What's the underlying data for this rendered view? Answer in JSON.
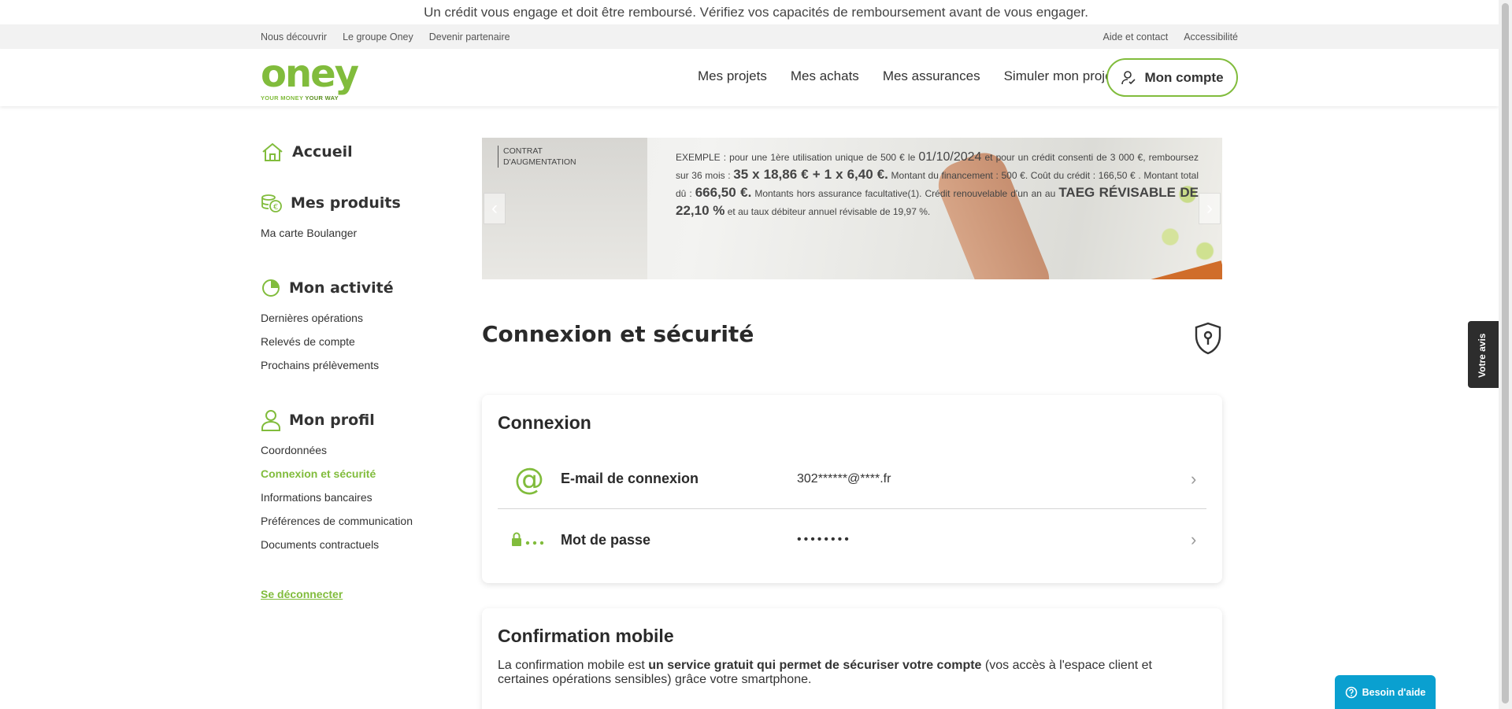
{
  "legal_notice": "Un crédit vous engage et doit être remboursé. Vérifiez vos capacités de remboursement avant de vous engager.",
  "topbar": {
    "left": [
      "Nous découvrir",
      "Le groupe Oney",
      "Devenir partenaire"
    ],
    "right": [
      "Aide et contact",
      "Accessibilité"
    ]
  },
  "header": {
    "logo_word": "oney",
    "logo_tagline_1": "YOUR MONEY",
    "logo_tagline_2": "YOUR WAY",
    "nav": [
      "Mes projets",
      "Mes achats",
      "Mes assurances",
      "Simuler mon projet"
    ],
    "account_button": "Mon compte"
  },
  "sidebar": {
    "home": "Accueil",
    "products": {
      "title": "Mes produits",
      "items": [
        "Ma carte Boulanger"
      ]
    },
    "activity": {
      "title": "Mon activité",
      "items": [
        "Dernières opérations",
        "Relevés de compte",
        "Prochains prélèvements"
      ]
    },
    "profile": {
      "title": "Mon profil",
      "items": [
        "Coordonnées",
        "Connexion et sécurité",
        "Informations bancaires",
        "Préférences de communication",
        "Documents contractuels"
      ]
    },
    "logout": "Se déconnecter"
  },
  "banner": {
    "contract_1": "CONTRAT",
    "contract_2": "D'AUGMENTATION",
    "ex_1": "EXEMPLE : pour une 1ère utilisation unique de 500 € le ",
    "ex_date": "01/10/2024",
    "ex_2": " et pour un crédit consenti de 3 000 €, remboursez sur 36 mois : ",
    "ex_monthly": "35 x 18,86 € + 1 x 6,40 €.",
    "ex_3": " Montant du financement : 500 €. Coût du crédit : 166,50 € . Montant total dû : ",
    "ex_total": "666,50 €.",
    "ex_4": " Montants hors assurance facultative(1). Crédit renouvelable d'un an au ",
    "ex_taeg": "TAEG RÉVISABLE DE 22,10 %",
    "ex_5": " et au taux débiteur annuel révisable de 19,97 %."
  },
  "page_title": "Connexion et sécurité",
  "connexion": {
    "title": "Connexion",
    "email_label": "E-mail de connexion",
    "email_value": "302******@****.fr",
    "password_label": "Mot de passe",
    "password_value": "••••••••"
  },
  "mobile": {
    "title": "Confirmation mobile",
    "desc_1": "La confirmation mobile est ",
    "desc_bold": "un service gratuit qui permet de sécuriser votre compte",
    "desc_2": " (vos accès à l'espace client et certaines opérations sensibles) grâce votre smartphone."
  },
  "feedback_tab": "Votre avis",
  "help_button": "Besoin d'aide",
  "colors": {
    "brand_green": "#81bc3c",
    "help_blue": "#0aa0d0"
  }
}
